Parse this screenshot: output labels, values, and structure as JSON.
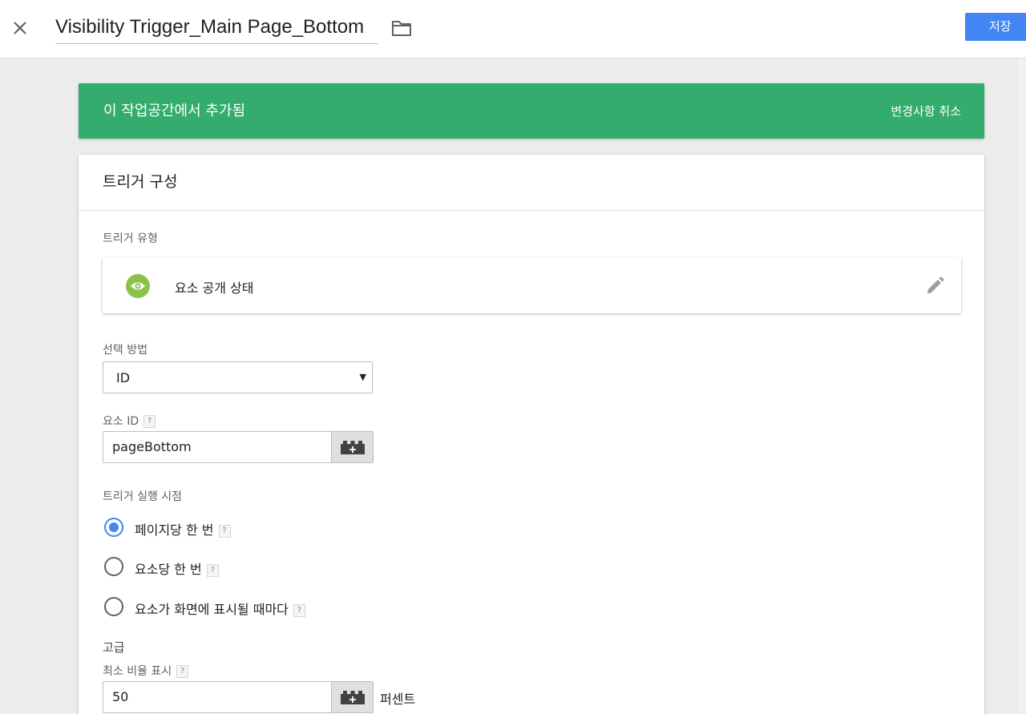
{
  "header": {
    "close_icon": "close-icon",
    "title": "Visibility Trigger_Main Page_Bottom",
    "folder_icon": "folder-icon",
    "save_label": "저장",
    "save_color": "#4285f4"
  },
  "banner": {
    "message": "이 작업공간에서 추가됨",
    "revert_label": "변경사항 취소",
    "color": "#34ac6e"
  },
  "config": {
    "title": "트리거 구성",
    "trigger_type_label": "트리거 유형",
    "trigger_type": {
      "icon": "eye-icon",
      "icon_color": "#8bc34a",
      "name": "요소 공개 상태",
      "edit_icon": "pencil-icon"
    },
    "selection_method_label": "선택 방법",
    "selection_method_value": "ID",
    "element_id_label": "요소 ID",
    "element_id_help": "?",
    "element_id_value": "pageBottom",
    "variable_icon": "lego-variable-icon",
    "fire_when_label": "트리거 실행 시점",
    "fire_options": [
      {
        "label": "페이지당 한 번",
        "help": "?",
        "selected": true
      },
      {
        "label": "요소당 한 번",
        "help": "?",
        "selected": false
      },
      {
        "label": "요소가 화면에 표시될 때마다",
        "help": "?",
        "selected": false
      }
    ],
    "advanced_label": "고급",
    "min_percent_label": "최소 비율 표시",
    "min_percent_help": "?",
    "min_percent_value": "50",
    "min_percent_unit": "퍼센트"
  }
}
